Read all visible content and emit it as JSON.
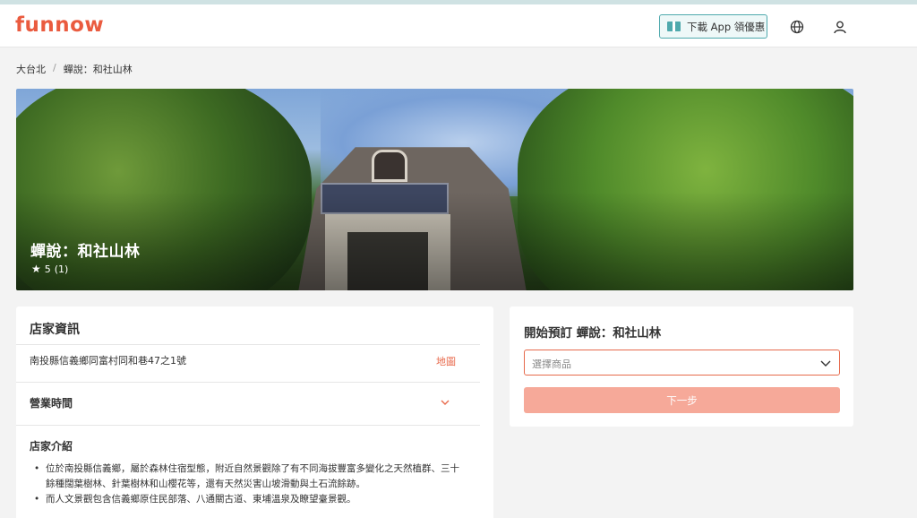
{
  "header": {
    "logo": "funnow",
    "app_button_label": "下載 App 領優惠"
  },
  "breadcrumb": {
    "items": [
      "大台北",
      "蟬說：和社山林"
    ],
    "separator": "/"
  },
  "hero": {
    "title": "蟬說：和社山林",
    "rating": "5",
    "review_count": "(1)"
  },
  "store_info": {
    "section_title": "店家資訊",
    "address": "南投縣信義鄉同富村同和巷47之1號",
    "map_link": "地圖",
    "hours_title": "營業時間",
    "intro_title": "店家介紹",
    "intro_items": [
      "位於南投縣信義鄉，屬於森林住宿型態，附近自然景觀除了有不同海拔豐富多變化之天然植群、三十餘種闊葉樹林、針葉樹林和山櫻花等，還有天然災害山坡滑動與土石流餘跡。",
      "而人文景觀包含信義鄉原住民部落、八通關古道、東埔溫泉及瞭望臺景觀。"
    ]
  },
  "booking": {
    "title": "開始預訂 蟬說：和社山林",
    "select_placeholder": "選擇商品",
    "next_button": "下一步"
  },
  "colors": {
    "brand": "#ea5b3f",
    "accent_teal": "#4fa9ad",
    "button_disabled": "#f6a999"
  },
  "icons": [
    "gift-icon",
    "globe-icon",
    "user-icon",
    "star-icon",
    "chevron-down-icon"
  ]
}
